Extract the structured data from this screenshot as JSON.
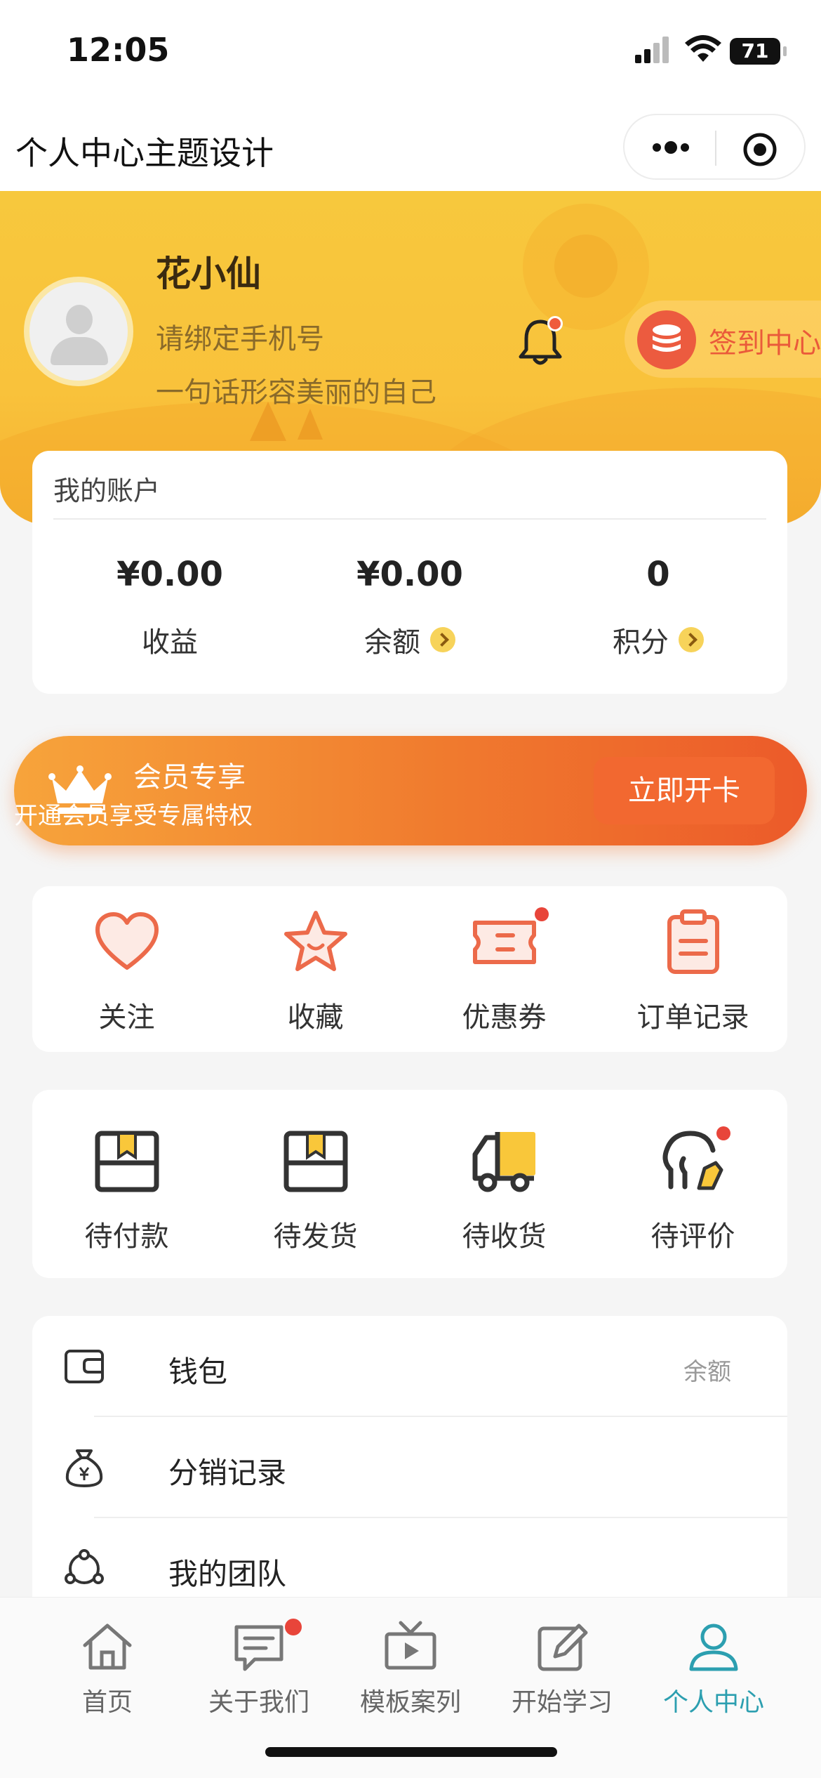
{
  "status_bar": {
    "time": "12:05",
    "battery": "71"
  },
  "navbar": {
    "title": "个人中心主题设计"
  },
  "profile": {
    "name": "花小仙",
    "phone_prompt": "请绑定手机号",
    "motto": "一句话形容美丽的自己",
    "signin_label": "签到中心"
  },
  "account": {
    "title": "我的账户",
    "items": [
      {
        "value": "¥0.00",
        "label": "收益"
      },
      {
        "value": "¥0.00",
        "label": "余额"
      },
      {
        "value": "0",
        "label": "积分"
      }
    ]
  },
  "vip": {
    "title": "会员专享",
    "subtitle": "开通会员享受专属特权",
    "button": "立即开卡"
  },
  "quick_actions": [
    {
      "label": "关注",
      "icon": "heart-icon"
    },
    {
      "label": "收藏",
      "icon": "star-icon"
    },
    {
      "label": "优惠券",
      "icon": "coupon-icon"
    },
    {
      "label": "订单记录",
      "icon": "clipboard-icon"
    }
  ],
  "orders": [
    {
      "label": "待付款",
      "icon": "box-icon"
    },
    {
      "label": "待发货",
      "icon": "box-icon"
    },
    {
      "label": "待收货",
      "icon": "truck-icon"
    },
    {
      "label": "待评价",
      "icon": "review-icon"
    }
  ],
  "menu": [
    {
      "label": "钱包",
      "extra": "余额",
      "icon": "wallet-icon"
    },
    {
      "label": "分销记录",
      "extra": "",
      "icon": "money-bag-icon"
    },
    {
      "label": "我的团队",
      "extra": "",
      "icon": "team-icon"
    }
  ],
  "tabbar": [
    {
      "label": "首页",
      "icon": "home-icon"
    },
    {
      "label": "关于我们",
      "icon": "message-icon"
    },
    {
      "label": "模板案列",
      "icon": "tv-icon"
    },
    {
      "label": "开始学习",
      "icon": "edit-icon"
    },
    {
      "label": "个人中心",
      "icon": "user-icon",
      "active": true
    }
  ],
  "colors": {
    "accent": "#2c9fb0",
    "brand_yellow": "#f9c23b",
    "orange": "#f07a2e",
    "icon_orange": "#ec6a4a"
  }
}
